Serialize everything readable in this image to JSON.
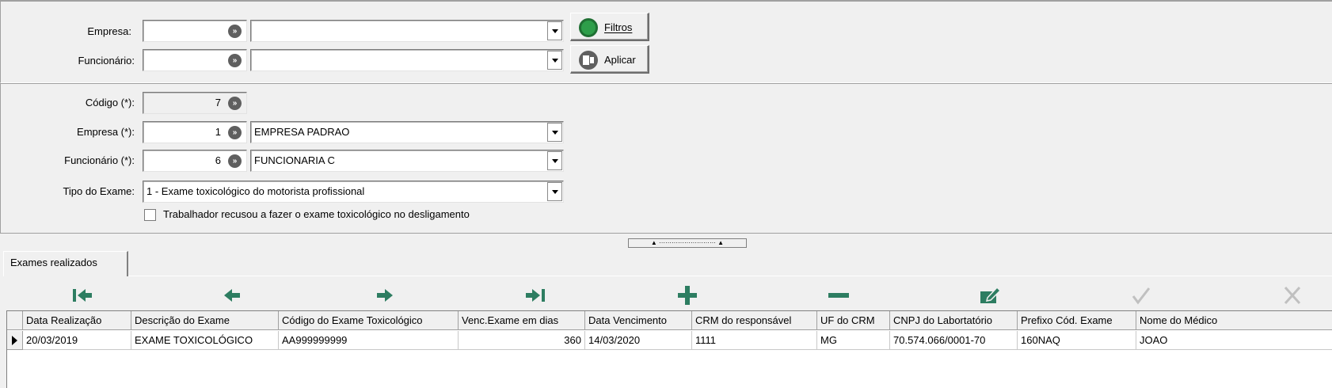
{
  "filter": {
    "empresa_label": "Empresa:",
    "funcionario_label": "Funcionário:",
    "empresa_code": "",
    "empresa_name": "",
    "funcionario_code": "",
    "funcionario_name": "",
    "filtros_button": "Filtros",
    "aplicar_button": "Aplicar"
  },
  "form": {
    "codigo_label": "Código (*):",
    "codigo_value": "7",
    "empresa_label": "Empresa (*):",
    "empresa_code": "1",
    "empresa_name": "EMPRESA PADRAO",
    "funcionario_label": "Funcionário (*):",
    "funcionario_code": "6",
    "funcionario_name": "FUNCIONARIA C",
    "tipo_label": "Tipo do Exame:",
    "tipo_value": "1 - Exame toxicológico do motorista profissional",
    "checkbox_label": "Trabalhador recusou a fazer o exame toxicológico no desligamento",
    "checkbox_checked": false
  },
  "tab": {
    "label": "Exames realizados"
  },
  "toolbar": [
    "first-icon",
    "prior-icon",
    "next-icon",
    "last-icon",
    "insert-icon",
    "delete-icon",
    "edit-icon",
    "post-icon",
    "cancel-icon"
  ],
  "grid": {
    "columns": [
      "Data Realização",
      "Descrição do Exame",
      "Código do Exame Toxicológico",
      "Venc.Exame em dias",
      "Data Vencimento",
      "CRM do responsável",
      "UF do  CRM",
      "CNPJ do Labortatório",
      "Prefixo Cód. Exame",
      "Nome do Médico"
    ],
    "rows": [
      [
        "20/03/2019",
        "EXAME TOXICOLÓGICO",
        "AA999999999",
        "360",
        "14/03/2020",
        "1111",
        "MG",
        "70.574.066/0001-70",
        "160NAQ",
        "JOAO"
      ]
    ]
  },
  "colors": {
    "nav_icon": "#2d7d61",
    "filtros_icon": "#2e9e4a",
    "disabled_icon": "#c0c0c0"
  }
}
